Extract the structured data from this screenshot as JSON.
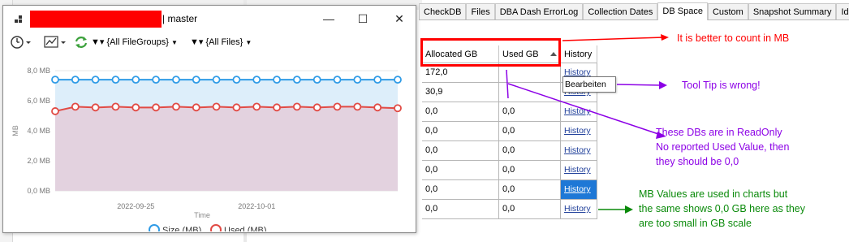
{
  "window": {
    "title_suffix": "| master",
    "minimize": "—",
    "maximize": "☐",
    "close": "✕"
  },
  "toolbar": {
    "filegroups": "{All FileGroups}",
    "files": "{All Files}"
  },
  "tabs": [
    "CheckDB",
    "Files",
    "DBA Dash ErrorLog",
    "Collection Dates",
    "DB Space",
    "Custom",
    "Snapshot Summary",
    "Identi"
  ],
  "active_tab": "DB Space",
  "grid": {
    "columns": [
      "Allocated GB",
      "Used GB",
      "History"
    ],
    "rows": [
      {
        "allocated": "172,0",
        "used": "",
        "history": "History"
      },
      {
        "allocated": "30,9",
        "used": "",
        "history": "History"
      },
      {
        "allocated": "0,0",
        "used": "0,0",
        "history": "History"
      },
      {
        "allocated": "0,0",
        "used": "0,0",
        "history": "History"
      },
      {
        "allocated": "0,0",
        "used": "0,0",
        "history": "History"
      },
      {
        "allocated": "0,0",
        "used": "0,0",
        "history": "History"
      },
      {
        "allocated": "0,0",
        "used": "0,0",
        "history": "History"
      },
      {
        "allocated": "0,0",
        "used": "0,0",
        "history": "History"
      }
    ],
    "selected_row": 6
  },
  "tooltip": "Bearbeiten",
  "annotations": {
    "mb": "It is better to count in MB",
    "tooltip": "Tool Tip is wrong!",
    "readonly": [
      "These DBs are in ReadOnly",
      "No reported Used Value, then",
      "they should be 0,0"
    ],
    "mbvalues": [
      "MB Values are used in charts but",
      "the same shows 0,0 GB here as they",
      "are too small in GB scale"
    ]
  },
  "colors": {
    "annotation_red": "#ff0000",
    "annotation_purple": "#8c00e6",
    "annotation_green": "#0a8a0a",
    "series_size": "#2f9be6",
    "series_used": "#e14b45",
    "selected": "#1e78d6"
  },
  "chart_data": {
    "type": "line",
    "title": "",
    "xlabel": "Time",
    "ylabel": "MB",
    "ylim": [
      0,
      8
    ],
    "y_ticks": [
      "0,0 MB",
      "2,0 MB",
      "4,0 MB",
      "6,0 MB",
      "8,0 MB"
    ],
    "x_ticks": [
      "2022-09-25",
      "2022-10-01"
    ],
    "x_tick_positions": [
      4,
      10
    ],
    "series": [
      {
        "name": "Size (MB)",
        "values": [
          7.4,
          7.4,
          7.4,
          7.4,
          7.4,
          7.4,
          7.4,
          7.4,
          7.4,
          7.4,
          7.4,
          7.4,
          7.4,
          7.4,
          7.4,
          7.4,
          7.4,
          7.4
        ]
      },
      {
        "name": "Used (MB)",
        "values": [
          5.3,
          5.6,
          5.55,
          5.6,
          5.55,
          5.55,
          5.6,
          5.55,
          5.6,
          5.55,
          5.6,
          5.55,
          5.6,
          5.55,
          5.6,
          5.6,
          5.55,
          5.5
        ]
      }
    ],
    "legend": "bottom"
  }
}
